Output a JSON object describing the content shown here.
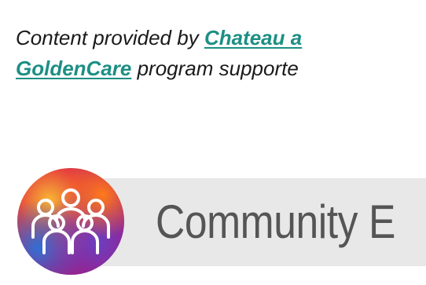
{
  "caption": {
    "prefix": "Content provided by ",
    "link1": "Chateau a",
    "link2": "GoldenCare",
    "suffix": " program supporte"
  },
  "banner": {
    "title": "Community E",
    "logo_icon": "community-people-icon"
  },
  "colors": {
    "link": "#1d8f84",
    "text": "#1a1a1a",
    "banner_bg": "#e8e8e8",
    "banner_text": "#555555"
  }
}
